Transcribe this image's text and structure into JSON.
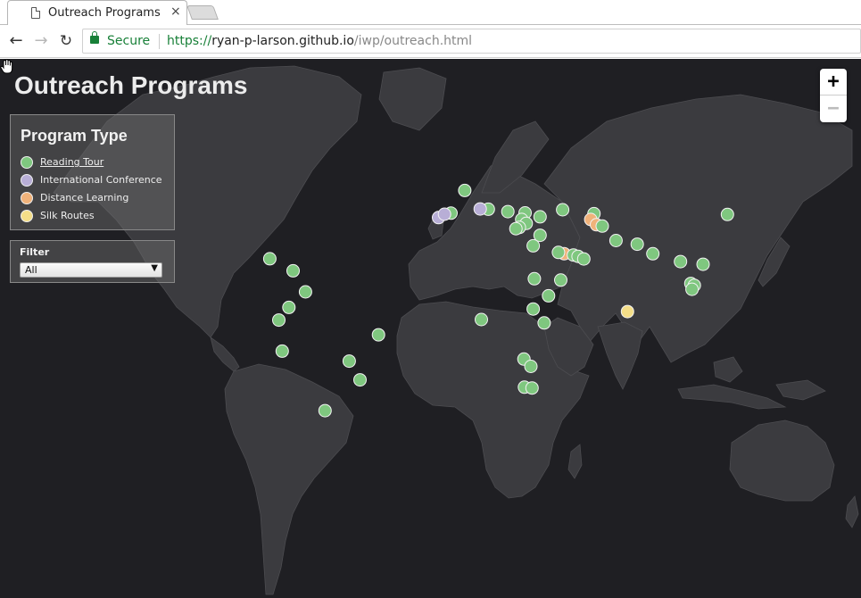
{
  "browser": {
    "tab_title": "Outreach Programs",
    "tab_close": "×",
    "secure_label": "Secure",
    "url_scheme": "https://",
    "url_host": "ryan-p-larson.github.io",
    "url_path": "/iwp/outreach.html"
  },
  "map": {
    "title": "Outreach Programs",
    "legend": {
      "title": "Program Type",
      "items": [
        {
          "label": "Reading Tour",
          "color": "#7fc77f"
        },
        {
          "label": "International Conference",
          "color": "#b8aed6"
        },
        {
          "label": "Distance Learning",
          "color": "#f0b27a"
        },
        {
          "label": "Silk Routes",
          "color": "#f4de88"
        }
      ]
    },
    "filter": {
      "label": "Filter",
      "selected": "All"
    },
    "zoom_in": "+",
    "zoom_out": "−",
    "colors": {
      "background": "#1f1f23",
      "land": "#3b3b3f",
      "border": "#4c4c50"
    },
    "markers": [
      {
        "type": "Reading Tour",
        "lat": 49.0,
        "lon": 2.3
      },
      {
        "type": "Reading Tour",
        "lat": 40.4,
        "lon": -3.7
      },
      {
        "type": "Reading Tour",
        "lat": 41.9,
        "lon": 12.5
      },
      {
        "type": "International Conference",
        "lat": 42.0,
        "lon": 9.0
      },
      {
        "type": "International Conference",
        "lat": 38.7,
        "lon": -9.1
      },
      {
        "type": "International Conference",
        "lat": 40.0,
        "lon": -6.5
      },
      {
        "type": "Reading Tour",
        "lat": 41.0,
        "lon": 21.0
      },
      {
        "type": "Reading Tour",
        "lat": 40.5,
        "lon": 28.5
      },
      {
        "type": "Reading Tour",
        "lat": 38.0,
        "lon": 27.0
      },
      {
        "type": "Reading Tour",
        "lat": 36.5,
        "lon": 29.0
      },
      {
        "type": "Reading Tour",
        "lat": 35.0,
        "lon": 26.0
      },
      {
        "type": "Reading Tour",
        "lat": 34.5,
        "lon": 24.5
      },
      {
        "type": "Reading Tour",
        "lat": 32.0,
        "lon": 35.0
      },
      {
        "type": "Reading Tour",
        "lat": 28.0,
        "lon": 32.0
      },
      {
        "type": "Reading Tour",
        "lat": 39.0,
        "lon": 35.0
      },
      {
        "type": "Reading Tour",
        "lat": 41.7,
        "lon": 44.8
      },
      {
        "type": "Reading Tour",
        "lat": 40.2,
        "lon": 58.4
      },
      {
        "type": "Distance Learning",
        "lat": 38.0,
        "lon": 57.0
      },
      {
        "type": "Distance Learning",
        "lat": 36.0,
        "lon": 59.5
      },
      {
        "type": "Reading Tour",
        "lat": 35.5,
        "lon": 62.0
      },
      {
        "type": "Reading Tour",
        "lat": 30.0,
        "lon": 68.0
      },
      {
        "type": "Reading Tour",
        "lat": 28.6,
        "lon": 77.2
      },
      {
        "type": "Distance Learning",
        "lat": 25.0,
        "lon": 45.5
      },
      {
        "type": "Reading Tour",
        "lat": 25.5,
        "lon": 43.0
      },
      {
        "type": "Reading Tour",
        "lat": 24.5,
        "lon": 49.5
      },
      {
        "type": "Reading Tour",
        "lat": 24.0,
        "lon": 51.5
      },
      {
        "type": "Reading Tour",
        "lat": 23.0,
        "lon": 54.0
      },
      {
        "type": "Reading Tour",
        "lat": 15.5,
        "lon": 32.5
      },
      {
        "type": "Reading Tour",
        "lat": 15.0,
        "lon": 44.0
      },
      {
        "type": "Reading Tour",
        "lat": 9.0,
        "lon": 38.7
      },
      {
        "type": "Reading Tour",
        "lat": 4.0,
        "lon": 32.0
      },
      {
        "type": "Reading Tour",
        "lat": 0.0,
        "lon": 9.5
      },
      {
        "type": "Reading Tour",
        "lat": -1.3,
        "lon": 36.8
      },
      {
        "type": "Reading Tour",
        "lat": -15.0,
        "lon": 28.0
      },
      {
        "type": "Reading Tour",
        "lat": -17.8,
        "lon": 31.0
      },
      {
        "type": "Reading Tour",
        "lat": -25.7,
        "lon": 28.2
      },
      {
        "type": "Reading Tour",
        "lat": -26.0,
        "lon": 31.5
      },
      {
        "type": "Reading Tour",
        "lat": 39.9,
        "lon": 116.4
      },
      {
        "type": "Reading Tour",
        "lat": 22.0,
        "lon": 96.0
      },
      {
        "type": "Reading Tour",
        "lat": 21.0,
        "lon": 105.8
      },
      {
        "type": "Reading Tour",
        "lat": 13.7,
        "lon": 100.5
      },
      {
        "type": "Reading Tour",
        "lat": 13.0,
        "lon": 102.0
      },
      {
        "type": "Reading Tour",
        "lat": 11.5,
        "lon": 101.0
      },
      {
        "type": "Reading Tour",
        "lat": 25.0,
        "lon": 84.0
      },
      {
        "type": "Silk Routes",
        "lat": 3.0,
        "lon": 73.0
      },
      {
        "type": "Reading Tour",
        "lat": 23.1,
        "lon": -82.4
      },
      {
        "type": "Reading Tour",
        "lat": 18.5,
        "lon": -72.3
      },
      {
        "type": "Reading Tour",
        "lat": 10.5,
        "lon": -66.9
      },
      {
        "type": "Reading Tour",
        "lat": 4.6,
        "lon": -74.1
      },
      {
        "type": "Reading Tour",
        "lat": -0.2,
        "lon": -78.5
      },
      {
        "type": "Reading Tour",
        "lat": -12.0,
        "lon": -77.0
      },
      {
        "type": "Reading Tour",
        "lat": -15.8,
        "lon": -47.9
      },
      {
        "type": "Reading Tour",
        "lat": -22.9,
        "lon": -43.2
      },
      {
        "type": "Reading Tour",
        "lat": -5.8,
        "lon": -35.2
      },
      {
        "type": "Reading Tour",
        "lat": -34.6,
        "lon": -58.4
      }
    ]
  }
}
